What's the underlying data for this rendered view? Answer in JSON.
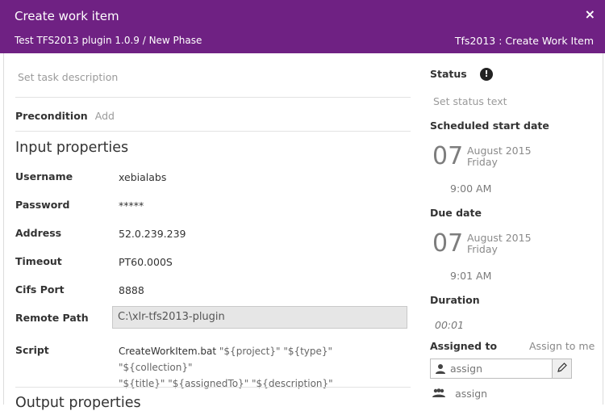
{
  "header": {
    "title": "Create work item",
    "close_glyph": "×",
    "subtitle": "Test TFS2013 plugin 1.0.9 / New Phase",
    "task_type": "Tfs2013 : Create Work Item"
  },
  "description": {
    "placeholder": "Set task description"
  },
  "precondition": {
    "label": "Precondition",
    "add_label": "Add"
  },
  "input_properties": {
    "title": "Input properties",
    "fields": [
      {
        "label": "Username",
        "value": "xebialabs"
      },
      {
        "label": "Password",
        "value": "*****"
      },
      {
        "label": "Address",
        "value": "52.0.239.239"
      },
      {
        "label": "Timeout",
        "value": "PT60.000S"
      },
      {
        "label": "Cifs Port",
        "value": "8888"
      }
    ],
    "remote_path": {
      "label": "Remote Path",
      "value": "C:\\xlr-tfs2013-plugin"
    },
    "script": {
      "label": "Script",
      "command": "CreateWorkItem.bat",
      "args_line1": "\"${project}\" \"${type}\" \"${collection}\"",
      "args_line2": "\"${title}\" \"${assignedTo}\" \"${description}\""
    }
  },
  "output_properties": {
    "title": "Output properties"
  },
  "status": {
    "label": "Status",
    "icon": "exclamation-icon",
    "placeholder": "Set status text"
  },
  "scheduled_start": {
    "label": "Scheduled start date",
    "day": "07",
    "month_year": "August 2015",
    "weekday": "Friday",
    "time": "9:00 AM"
  },
  "due_date": {
    "label": "Due date",
    "day": "07",
    "month_year": "August 2015",
    "weekday": "Friday",
    "time": "9:01 AM"
  },
  "duration": {
    "label": "Duration",
    "value": "00:01"
  },
  "assigned_to": {
    "label": "Assigned to",
    "assign_to_me": "Assign to me",
    "user_placeholder": "assign",
    "team_placeholder": "assign"
  },
  "colors": {
    "header_bg": "#6f2183",
    "header_text": "#ffffff"
  }
}
